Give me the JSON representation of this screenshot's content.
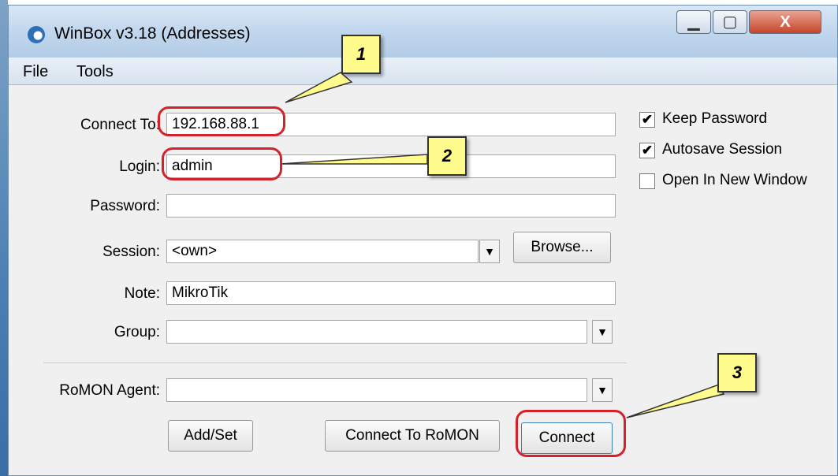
{
  "window": {
    "title": "WinBox v3.18 (Addresses)",
    "minimize": "▁",
    "maximize": "▢",
    "close": "X"
  },
  "menu": {
    "items": [
      "File",
      "Tools"
    ]
  },
  "form": {
    "connect_to_label": "Connect To:",
    "connect_to_value": "192.168.88.1",
    "login_label": "Login:",
    "login_value": "admin",
    "password_label": "Password:",
    "password_value": "",
    "session_label": "Session:",
    "session_value": "<own>",
    "browse_label": "Browse...",
    "note_label": "Note:",
    "note_value": "MikroTik",
    "group_label": "Group:",
    "group_value": "",
    "romon_label": "RoMON Agent:",
    "romon_value": ""
  },
  "options": [
    {
      "label": "Keep Password",
      "checked": true
    },
    {
      "label": "Autosave Session",
      "checked": true
    },
    {
      "label": "Open In New Window",
      "checked": false
    }
  ],
  "buttons": {
    "add_set": "Add/Set",
    "connect_romon": "Connect To RoMON",
    "connect": "Connect"
  },
  "callouts": {
    "c1": "1",
    "c2": "2",
    "c3": "3"
  },
  "icons": {
    "dropdown": "▼",
    "check": "✔"
  },
  "colors": {
    "highlight_ring": "#d5212a",
    "callout_fill": "#fffb8c"
  }
}
